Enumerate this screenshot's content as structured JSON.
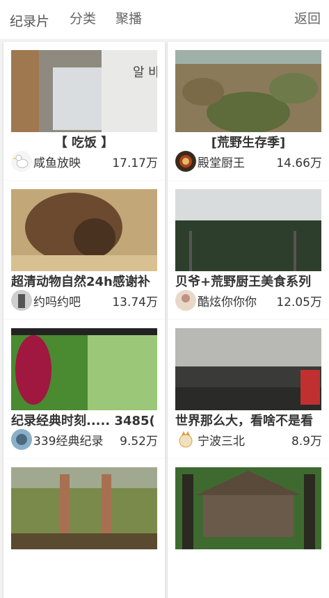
{
  "nav": {
    "tabs": [
      "纪录片",
      "分类",
      "聚播"
    ],
    "back_label": "返回"
  },
  "cards": [
    {
      "title": "【 吃饭 】",
      "uploader": "咸鱼放映",
      "views": "17.17万"
    },
    {
      "title": "[荒野生存季]",
      "uploader": "殿堂厨王",
      "views": "14.66万"
    },
    {
      "title": "超清动物自然24h感谢补",
      "uploader": "约吗约吧",
      "views": "13.74万"
    },
    {
      "title": "贝爷+荒野厨王美食系列",
      "uploader": "酷炫你你你",
      "views": "12.05万"
    },
    {
      "title": "纪录经典时刻..... 3485(",
      "uploader": "339经典纪录",
      "views": "9.52万"
    },
    {
      "title": "世界那么大，看啥不是看",
      "uploader": "宁波三北",
      "views": "8.9万"
    },
    {
      "title": "",
      "uploader": "",
      "views": ""
    },
    {
      "title": "",
      "uploader": "",
      "views": ""
    }
  ]
}
